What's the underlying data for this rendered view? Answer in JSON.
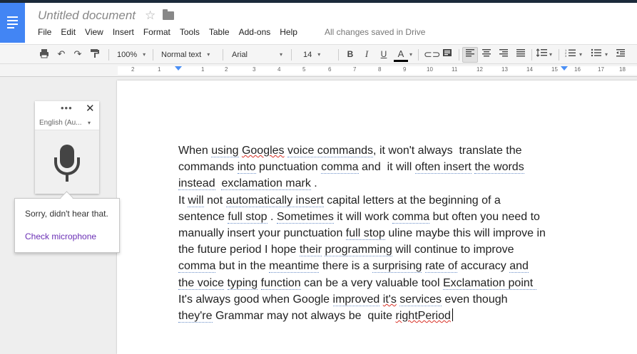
{
  "app": {
    "title": "Untitled document",
    "saved_status": "All changes saved in Drive"
  },
  "menu": [
    "File",
    "Edit",
    "View",
    "Insert",
    "Format",
    "Tools",
    "Table",
    "Add-ons",
    "Help"
  ],
  "toolbar": {
    "zoom": "100%",
    "style": "Normal text",
    "font": "Arial",
    "size": "14",
    "bold": "B",
    "italic": "I",
    "underline": "U",
    "text_color": "A"
  },
  "ruler": {
    "ticks": [
      "2",
      "1",
      "1",
      "2",
      "3",
      "4",
      "5",
      "6",
      "7",
      "8",
      "9",
      "10",
      "11",
      "12",
      "13",
      "14",
      "15",
      "16",
      "17",
      "18"
    ]
  },
  "voice_panel": {
    "dots": "•••",
    "close": "✕",
    "language": "English (Au...",
    "popup_message": "Sorry, didn't hear that.",
    "popup_link": "Check microphone"
  },
  "document": {
    "lines": [
      [
        {
          "t": "When "
        },
        {
          "t": "using",
          "c": "sp"
        },
        {
          "t": " "
        },
        {
          "t": "Googles",
          "c": "err"
        },
        {
          "t": " "
        },
        {
          "t": "voice commands",
          "c": "sp"
        },
        {
          "t": ", it won't always  translate the"
        }
      ],
      [
        {
          "t": "commands "
        },
        {
          "t": "into",
          "c": "sp"
        },
        {
          "t": " punctuation "
        },
        {
          "t": "comma",
          "c": "sp"
        },
        {
          "t": " and  it will "
        },
        {
          "t": "often insert",
          "c": "sp"
        },
        {
          "t": " "
        },
        {
          "t": "the words",
          "c": "sp"
        }
      ],
      [
        {
          "t": "instead",
          "c": "sp"
        },
        {
          "t": "  "
        },
        {
          "t": "exclamation mark",
          "c": "sp"
        },
        {
          "t": " ."
        }
      ],
      [
        {
          "t": "It "
        },
        {
          "t": "will",
          "c": "sp"
        },
        {
          "t": " not "
        },
        {
          "t": "automatically insert",
          "c": "sp"
        },
        {
          "t": " capital letters at the beginning of a"
        }
      ],
      [
        {
          "t": "sentence "
        },
        {
          "t": "full stop",
          "c": "sp"
        },
        {
          "t": " . "
        },
        {
          "t": "Sometimes",
          "c": "sp"
        },
        {
          "t": " it will work "
        },
        {
          "t": "comma",
          "c": "sp"
        },
        {
          "t": " but often you need to"
        }
      ],
      [
        {
          "t": "manually insert your punctuation "
        },
        {
          "t": "full stop",
          "c": "sp"
        },
        {
          "t": " uline maybe this will improve in"
        }
      ],
      [
        {
          "t": "the future period I hope "
        },
        {
          "t": "their",
          "c": "sp"
        },
        {
          "t": " "
        },
        {
          "t": "programming",
          "c": "sp"
        },
        {
          "t": " will continue to improve"
        }
      ],
      [
        {
          "t": "comma",
          "c": "sp"
        },
        {
          "t": " but in the "
        },
        {
          "t": "meantime",
          "c": "sp"
        },
        {
          "t": " there is a "
        },
        {
          "t": "surprising",
          "c": "sp"
        },
        {
          "t": " "
        },
        {
          "t": "rate of",
          "c": "sp"
        },
        {
          "t": " accuracy "
        },
        {
          "t": "and",
          "c": "sp"
        }
      ],
      [
        {
          "t": "the voice",
          "c": "sp"
        },
        {
          "t": " "
        },
        {
          "t": "typing",
          "c": "sp"
        },
        {
          "t": " "
        },
        {
          "t": "function",
          "c": "sp"
        },
        {
          "t": " can be a very valuable tool "
        },
        {
          "t": "Exclamation point ",
          "c": "sp"
        }
      ],
      [
        {
          "t": "It's always good when Google "
        },
        {
          "t": "improved",
          "c": "sp"
        },
        {
          "t": " "
        },
        {
          "t": "it's",
          "c": "err"
        },
        {
          "t": " "
        },
        {
          "t": "services",
          "c": "sp"
        },
        {
          "t": " even though"
        }
      ],
      [
        {
          "t": "they're",
          "c": "sp"
        },
        {
          "t": " Grammar may not always be  quite "
        },
        {
          "t": "rightPeriod",
          "c": "err"
        }
      ]
    ]
  }
}
